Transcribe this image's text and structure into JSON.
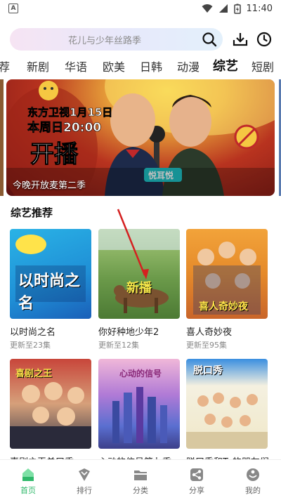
{
  "status_bar": {
    "notification_icon": "a-square-icon",
    "time": "11:40"
  },
  "search": {
    "placeholder": "花儿与少年丝路季"
  },
  "tabs": [
    {
      "label": "荐"
    },
    {
      "label": "新剧"
    },
    {
      "label": "华语"
    },
    {
      "label": "欧美"
    },
    {
      "label": "日韩"
    },
    {
      "label": "动漫"
    },
    {
      "label": "综艺",
      "active": true
    },
    {
      "label": "短剧"
    }
  ],
  "banner": {
    "caption": "今晚开放麦第二季",
    "poster_text": {
      "date_line": "东方卫视1月15日",
      "time_line": "本周日20:00",
      "headline": "开播",
      "badge": "悦耳悦"
    }
  },
  "section": {
    "title": "综艺推荐",
    "items": [
      {
        "title": "以时尚之名",
        "update": "更新至23集",
        "poster_text": "以时尚之名"
      },
      {
        "title": "你好种地少年2",
        "update": "更新至12集",
        "poster_text": "新播"
      },
      {
        "title": "喜人奇妙夜",
        "update": "更新至95集",
        "poster_text": "喜人奇妙夜"
      },
      {
        "title": "喜剧之王单口季",
        "update": "",
        "poster_text": "喜剧之王"
      },
      {
        "title": "心动的信号第七季",
        "update": "",
        "poster_text": "心动的信号"
      },
      {
        "title": "脱口秀和Ta的朋友们",
        "update": "",
        "poster_text": "脱口秀"
      }
    ]
  },
  "bottom_nav": [
    {
      "label": "首页",
      "icon": "home-icon",
      "active": true
    },
    {
      "label": "排行",
      "icon": "ranking-icon"
    },
    {
      "label": "分类",
      "icon": "folder-icon"
    },
    {
      "label": "分享",
      "icon": "share-icon"
    },
    {
      "label": "我的",
      "icon": "profile-icon"
    }
  ],
  "colors": {
    "accent": "#2fb86a",
    "pointer": "#d42020"
  }
}
